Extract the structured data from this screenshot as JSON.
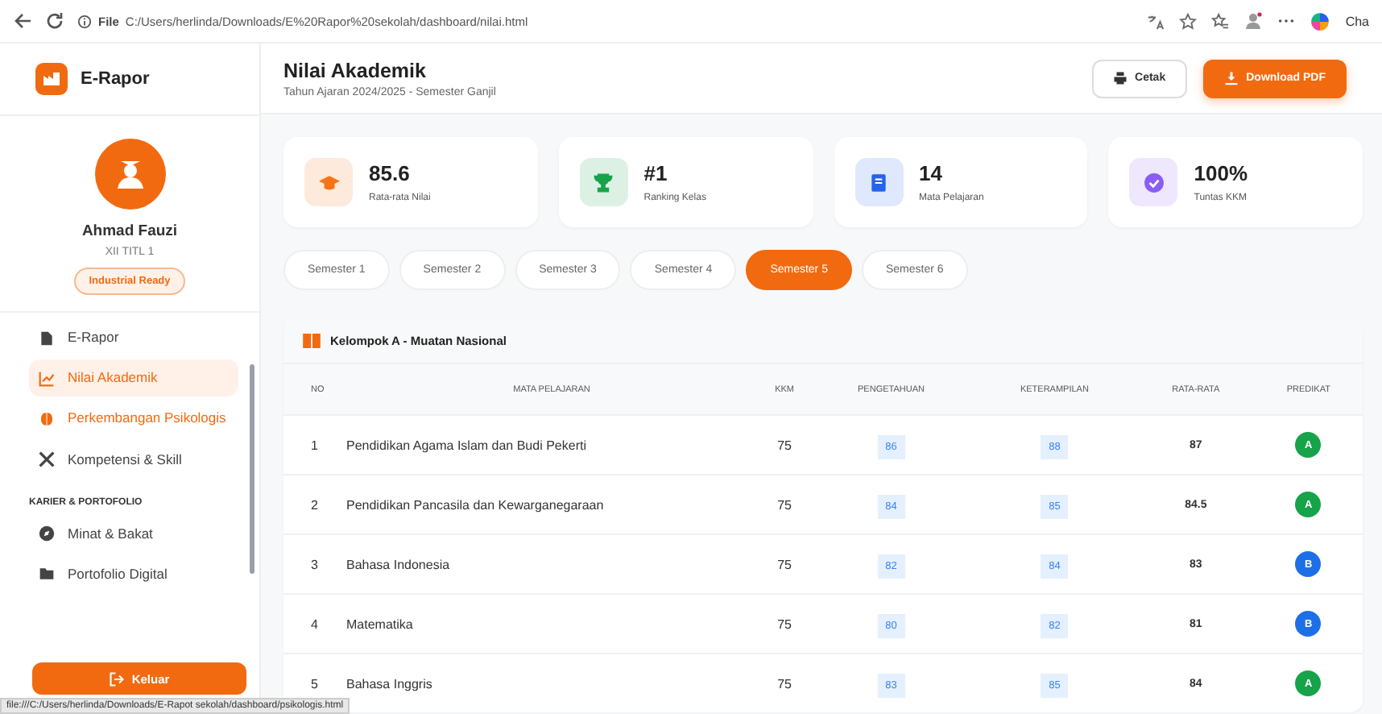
{
  "browser": {
    "scheme": "File",
    "url": "C:/Users/herlinda/Downloads/E%20Rapor%20sekolah/dashboard/nilai.html",
    "profile_label": "Cha"
  },
  "sidebar": {
    "brand": "E-Rapor",
    "profile": {
      "name": "Ahmad Fauzi",
      "class": "XII TITL 1",
      "badge": "Industrial Ready"
    },
    "items": [
      {
        "kind": "item",
        "label": "E-Rapor",
        "selected": false,
        "highlighted": false
      },
      {
        "kind": "item",
        "label": "Nilai Akademik",
        "selected": true,
        "highlighted": false
      },
      {
        "kind": "item",
        "label": "Perkembangan Psikologis",
        "selected": false,
        "highlighted": true
      },
      {
        "kind": "item",
        "label": "Kompetensi & Skill",
        "selected": false,
        "highlighted": false
      },
      {
        "kind": "heading",
        "label": "KARIER & PORTOFOLIO"
      },
      {
        "kind": "item",
        "label": "Minat & Bakat",
        "selected": false,
        "highlighted": false
      },
      {
        "kind": "item",
        "label": "Portofolio Digital",
        "selected": false,
        "highlighted": false
      }
    ],
    "logout": "Keluar"
  },
  "header": {
    "title": "Nilai Akademik",
    "subtitle": "Tahun Ajaran 2024/2025 - Semester Ganjil",
    "buttons": [
      {
        "kind": "print",
        "label": "Cetak"
      },
      {
        "kind": "download",
        "label": "Download PDF"
      }
    ]
  },
  "stats": [
    {
      "value": "85.6",
      "label": "Rata-rata Nilai",
      "color": "#f97316"
    },
    {
      "value": "#1",
      "label": "Ranking Kelas",
      "color": "#16a34a"
    },
    {
      "value": "14",
      "label": "Mata Pelajaran",
      "color": "#2563eb"
    },
    {
      "value": "100%",
      "label": "Tuntas KKM",
      "color": "#8b5cf6"
    }
  ],
  "tabs": [
    {
      "label": "Semester 1",
      "selected": false
    },
    {
      "label": "Semester 2",
      "selected": false
    },
    {
      "label": "Semester 3",
      "selected": false
    },
    {
      "label": "Semester 4",
      "selected": false
    },
    {
      "label": "Semester 5",
      "selected": true
    },
    {
      "label": "Semester 6",
      "selected": false
    }
  ],
  "table": {
    "title": "Kelompok A - Muatan Nasional",
    "columns": [
      "NO",
      "MATA PELAJARAN",
      "KKM",
      "PENGETAHUAN",
      "KETERAMPILAN",
      "RATA-RATA",
      "PREDIKAT"
    ],
    "rows": [
      {
        "no": "1",
        "subject": "Pendidikan Agama Islam dan Budi Pekerti",
        "kkm": "75",
        "pengetahuan": "86",
        "keterampilan": "88",
        "rata_rata": "87",
        "predikat": "A",
        "color": "#16a34a"
      },
      {
        "no": "2",
        "subject": "Pendidikan Pancasila dan Kewarganegaraan",
        "kkm": "75",
        "pengetahuan": "84",
        "keterampilan": "85",
        "rata_rata": "84.5",
        "predikat": "A",
        "color": "#16a34a"
      },
      {
        "no": "3",
        "subject": "Bahasa Indonesia",
        "kkm": "75",
        "pengetahuan": "82",
        "keterampilan": "84",
        "rata_rata": "83",
        "predikat": "B",
        "color": "#1d6fe8"
      },
      {
        "no": "4",
        "subject": "Matematika",
        "kkm": "75",
        "pengetahuan": "80",
        "keterampilan": "82",
        "rata_rata": "81",
        "predikat": "B",
        "color": "#1d6fe8"
      },
      {
        "no": "5",
        "subject": "Bahasa Inggris",
        "kkm": "75",
        "pengetahuan": "83",
        "keterampilan": "85",
        "rata_rata": "84",
        "predikat": "A",
        "color": "#16a34a"
      }
    ]
  },
  "status_bar": "file:///C:/Users/herlinda/Downloads/E-Rapot sekolah/dashboard/psikologis.html"
}
